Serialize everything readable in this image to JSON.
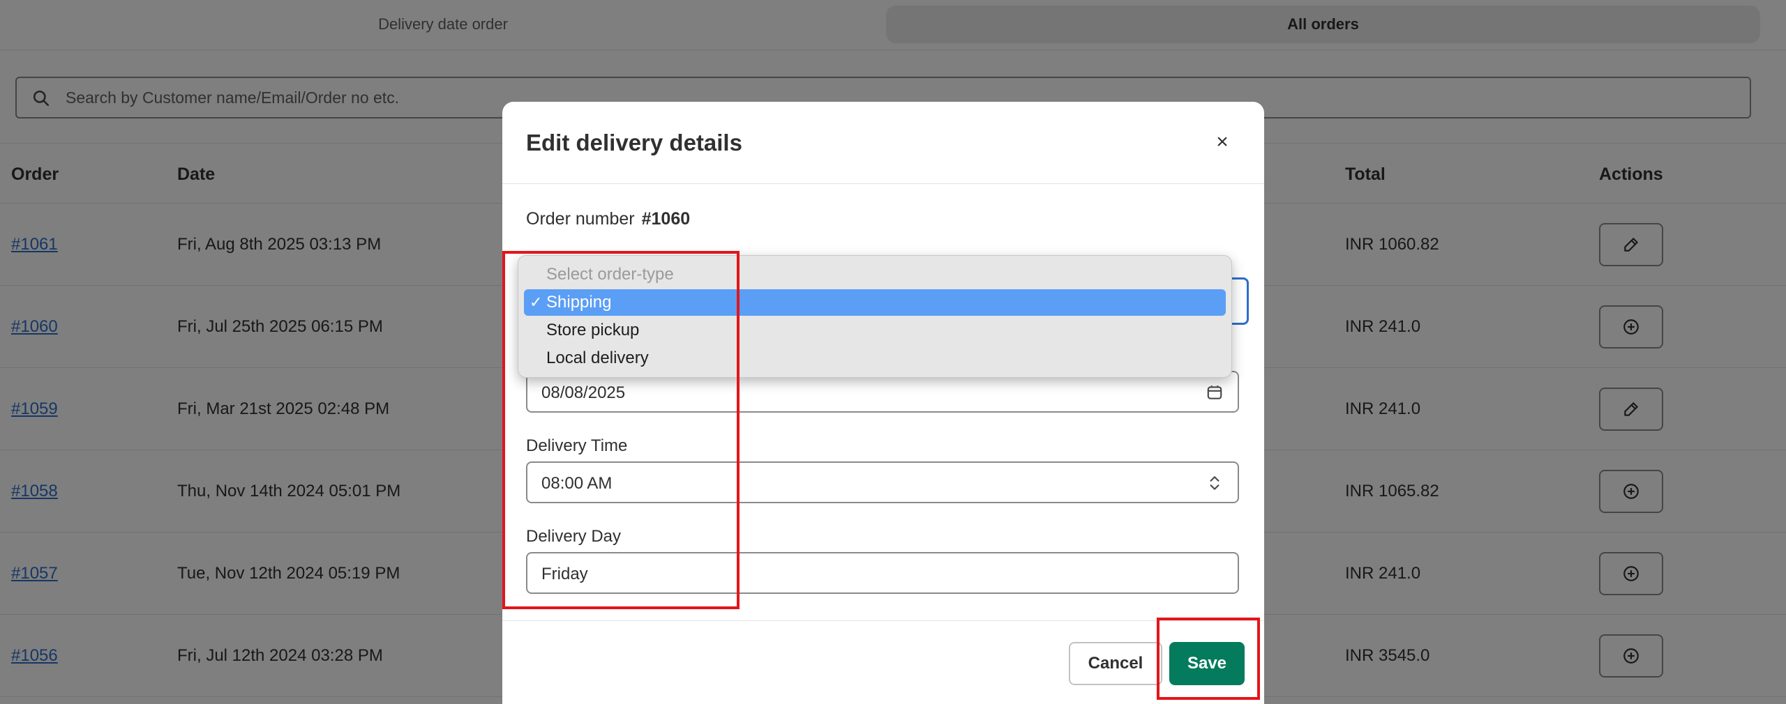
{
  "tabs": [
    {
      "label": "Delivery date order"
    },
    {
      "label": "All orders"
    }
  ],
  "search": {
    "placeholder": "Search by Customer name/Email/Order no etc."
  },
  "table": {
    "headers": {
      "order": "Order",
      "date": "Date",
      "total": "Total",
      "actions": "Actions"
    },
    "rows": [
      {
        "order": "#1061",
        "date": "Fri, Aug 8th 2025 03:13 PM",
        "total": "INR 1060.82",
        "action": "edit-icon"
      },
      {
        "order": "#1060",
        "date": "Fri, Jul 25th 2025 06:15 PM",
        "total": "INR 241.0",
        "action": "add-circle-icon"
      },
      {
        "order": "#1059",
        "date": "Fri, Mar 21st 2025 02:48 PM",
        "total": "INR 241.0",
        "action": "edit-icon"
      },
      {
        "order": "#1058",
        "date": "Thu, Nov 14th 2024 05:01 PM",
        "total": "INR 1065.82",
        "action": "add-circle-icon"
      },
      {
        "order": "#1057",
        "date": "Tue, Nov 12th 2024 05:19 PM",
        "total": "INR 241.0",
        "action": "add-circle-icon"
      },
      {
        "order": "#1056",
        "date": "Fri, Jul 12th 2024 03:28 PM",
        "total": "INR 3545.0",
        "action": "add-circle-icon"
      }
    ]
  },
  "modal": {
    "title": "Edit delivery details",
    "close": "×",
    "order_label": "Order number",
    "order_number": "#1060",
    "date_value": "08/08/2025",
    "time_label": "Delivery Time",
    "time_value": "08:00 AM",
    "day_label": "Delivery Day",
    "day_value": "Friday",
    "cancel_label": "Cancel",
    "save_label": "Save"
  },
  "dropdown": {
    "options": [
      {
        "label": "Select order-type",
        "disabled": true
      },
      {
        "label": "Shipping",
        "selected": true
      },
      {
        "label": "Store pickup"
      },
      {
        "label": "Local delivery"
      }
    ],
    "check": "✓"
  },
  "colors": {
    "link": "#2c6ecb",
    "primary_button": "#047b5d",
    "highlight_box": "#e3151b",
    "selected_option": "#5b9ef5"
  }
}
